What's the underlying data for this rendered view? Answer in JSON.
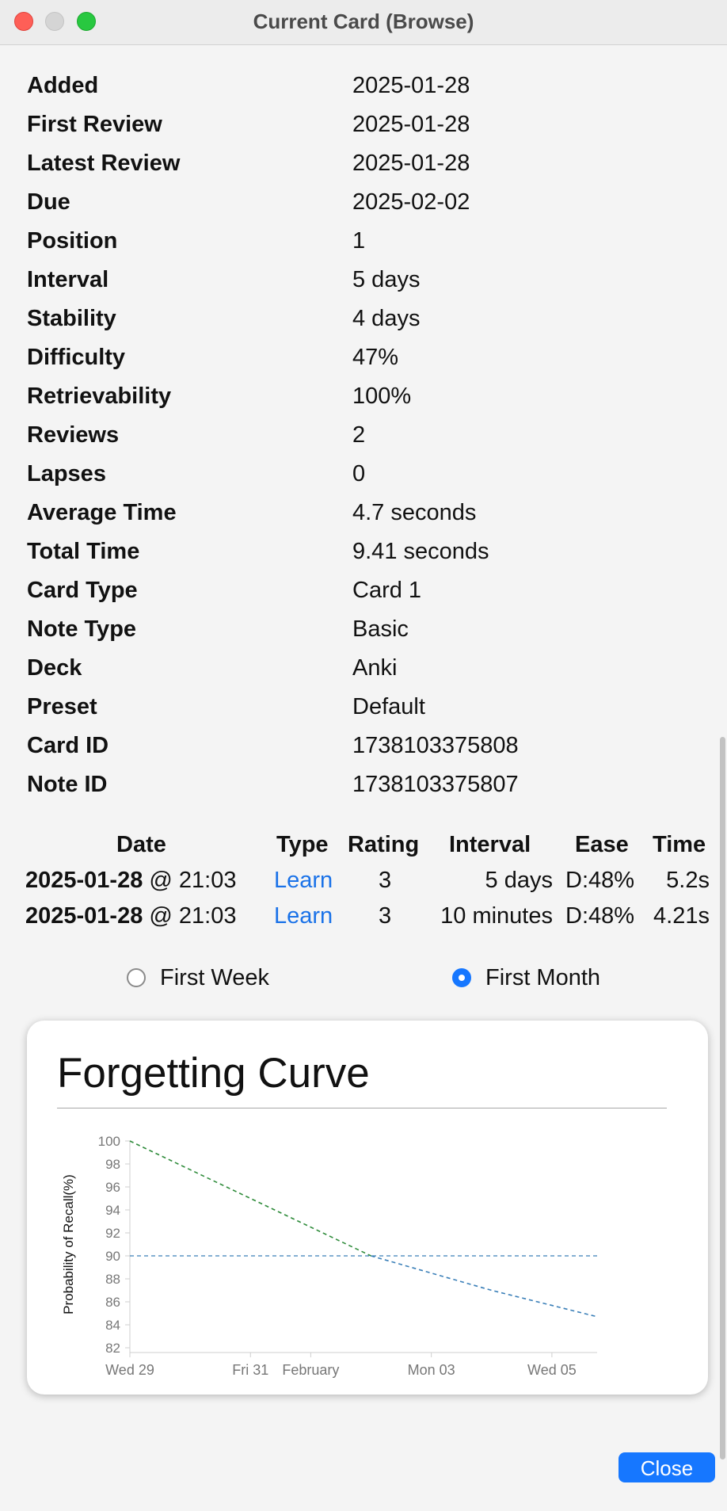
{
  "window": {
    "title": "Current Card (Browse)"
  },
  "info": [
    {
      "label": "Added",
      "value": "2025-01-28"
    },
    {
      "label": "First Review",
      "value": "2025-01-28"
    },
    {
      "label": "Latest Review",
      "value": "2025-01-28"
    },
    {
      "label": "Due",
      "value": "2025-02-02"
    },
    {
      "label": "Position",
      "value": "1"
    },
    {
      "label": "Interval",
      "value": "5 days"
    },
    {
      "label": "Stability",
      "value": "4 days"
    },
    {
      "label": "Difficulty",
      "value": "47%"
    },
    {
      "label": "Retrievability",
      "value": "100%"
    },
    {
      "label": "Reviews",
      "value": "2"
    },
    {
      "label": "Lapses",
      "value": "0"
    },
    {
      "label": "Average Time",
      "value": "4.7 seconds"
    },
    {
      "label": "Total Time",
      "value": "9.41 seconds"
    },
    {
      "label": "Card Type",
      "value": "Card 1"
    },
    {
      "label": "Note Type",
      "value": "Basic"
    },
    {
      "label": "Deck",
      "value": "Anki"
    },
    {
      "label": "Preset",
      "value": "Default"
    },
    {
      "label": "Card ID",
      "value": "1738103375808"
    },
    {
      "label": "Note ID",
      "value": "1738103375807"
    }
  ],
  "reviews": {
    "headers": {
      "date": "Date",
      "type": "Type",
      "rating": "Rating",
      "interval": "Interval",
      "ease": "Ease",
      "time": "Time"
    },
    "rows": [
      {
        "date": "2025-01-28",
        "clock": "@ 21:03",
        "type": "Learn",
        "rating": "3",
        "interval": "5 days",
        "ease": "D:48%",
        "time": "5.2s"
      },
      {
        "date": "2025-01-28",
        "clock": "@ 21:03",
        "type": "Learn",
        "rating": "3",
        "interval": "10 minutes",
        "ease": "D:48%",
        "time": "4.21s"
      }
    ]
  },
  "range_options": {
    "first_week": {
      "label": "First Week",
      "selected": false
    },
    "first_month": {
      "label": "First Month",
      "selected": true
    }
  },
  "colors": {
    "accent": "#1677ff",
    "link": "#1a72e8",
    "curve_reviewed": "#2e8b3a",
    "curve_projected": "#3a7fb8",
    "threshold": "#3a7fb8"
  },
  "chart_data": {
    "type": "line",
    "title": "Forgetting Curve",
    "ylabel": "Probability of Recall(%)",
    "xlabel": "",
    "ylim": [
      82,
      100
    ],
    "yticks": [
      82,
      84,
      86,
      88,
      90,
      92,
      94,
      96,
      98,
      100
    ],
    "xlim": [
      "2025-01-29",
      "2025-02-05T18:00"
    ],
    "xticks": [
      {
        "x": "2025-01-29",
        "label": "Wed 29"
      },
      {
        "x": "2025-01-31",
        "label": "Fri 31"
      },
      {
        "x": "2025-02-01",
        "label": "February"
      },
      {
        "x": "2025-02-03",
        "label": "Mon 03"
      },
      {
        "x": "2025-02-05",
        "label": "Wed 05"
      }
    ],
    "series": [
      {
        "style": "dashed",
        "color": "#2e8b3a",
        "points": [
          [
            "2025-01-29",
            100
          ],
          [
            "2025-01-31",
            95.0
          ],
          [
            "2025-02-02",
            90.0
          ]
        ]
      },
      {
        "style": "dashed",
        "color": "#3a7fb8",
        "points": [
          [
            "2025-02-02",
            90.0
          ],
          [
            "2025-02-04",
            87.0
          ],
          [
            "2025-02-05T18:00",
            84.7
          ]
        ]
      }
    ],
    "threshold": {
      "y": 90,
      "style": "dashed",
      "color": "#3a7fb8"
    },
    "grid": false,
    "legend": "none"
  },
  "footer": {
    "close_label": "Close"
  }
}
